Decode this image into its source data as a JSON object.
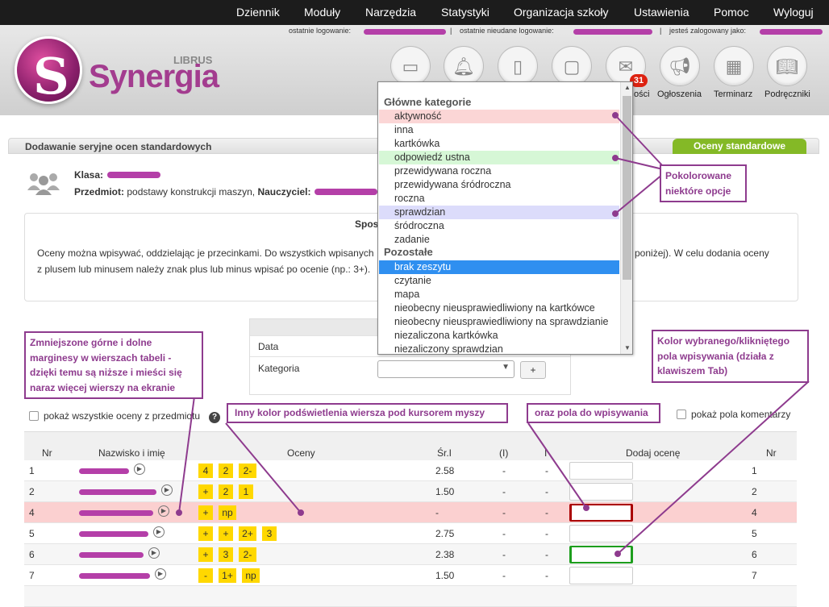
{
  "topnav": [
    "Dziennik",
    "Moduły",
    "Narzędzia",
    "Statystyki",
    "Organizacja szkoły",
    "Ustawienia",
    "Pomoc",
    "Wyloguj"
  ],
  "login": {
    "last": "ostatnie logowanie:",
    "last_failed": "ostatnie nieudane logowanie:",
    "logged_as": "jesteś zalogowany jako:",
    "sep": "|"
  },
  "logo": {
    "small": "LIBRUS",
    "big": "Synergia"
  },
  "header_icons": [
    {
      "icon": "chat-icon",
      "label": ""
    },
    {
      "icon": "bell-icon",
      "label": ""
    },
    {
      "icon": "calendar-5-icon",
      "label": ""
    },
    {
      "icon": "clipboard-icon",
      "label": ""
    },
    {
      "icon": "envelope-icon",
      "label": "ości"
    },
    {
      "icon": "megaphone-icon",
      "label": "Ogłoszenia"
    },
    {
      "icon": "organizer-icon",
      "label": "Terminarz"
    },
    {
      "icon": "book-icon",
      "label": "Podręczniki"
    }
  ],
  "badge": "31",
  "panel": {
    "title": "Dodawanie seryjne ocen standardowych",
    "tab": "Oceny standardowe",
    "klasa_label": "Klasa:",
    "przedmiot_label": "Przedmiot:",
    "przedmiot_value": "podstawy konstrukcji maszyn,",
    "nauczyciel_label": "Nauczyciel:"
  },
  "info": {
    "title": "Sposób",
    "line1a": "Oceny można wpisywać, oddzielając je przecinkami. Do wszystkich wpisanych",
    "line1b": "poniżej). W celu dodania oceny",
    "line2": "z plusem lub minusem należy znak plus lub minus wpisać po ocenie (np.: 3+)."
  },
  "form": {
    "data_label": "Data",
    "kategoria_label": "Kategoria",
    "plus": "+"
  },
  "checks": {
    "left": "pokaż wszystkie oceny z przedmiotu",
    "right": "pokaż pola komentarzy",
    "help": "?"
  },
  "table": {
    "headers": [
      "Nr",
      "Nazwisko i imię",
      "Oceny",
      "Śr.I",
      "(I)",
      "I",
      "Dodaj ocenę",
      "Nr"
    ],
    "rows": [
      {
        "nr": "1",
        "grades": [
          "4",
          "2",
          "2-"
        ],
        "sr": "2.58",
        "c1": "-",
        "c2": "-",
        "nr2": "1"
      },
      {
        "nr": "2",
        "grades": [
          "+",
          "2",
          "1"
        ],
        "sr": "1.50",
        "c1": "-",
        "c2": "-",
        "nr2": "2"
      },
      {
        "nr": "4",
        "grades": [
          "+",
          "np"
        ],
        "sr": "-",
        "c1": "-",
        "c2": "-",
        "nr2": "4"
      },
      {
        "nr": "5",
        "grades": [
          "+",
          "+",
          "2+",
          "3"
        ],
        "sr": "2.75",
        "c1": "-",
        "c2": "-",
        "nr2": "5"
      },
      {
        "nr": "6",
        "grades": [
          "+",
          "3",
          "2-"
        ],
        "sr": "2.38",
        "c1": "-",
        "c2": "-",
        "nr2": "6"
      },
      {
        "nr": "7",
        "grades": [
          "-",
          "1+",
          "np"
        ],
        "sr": "1.50",
        "c1": "-",
        "c2": "-",
        "nr2": "7"
      }
    ]
  },
  "dropdown": {
    "group1": "Główne kategorie",
    "group1_items": [
      "aktywność",
      "inna",
      "kartkówka",
      "odpowiedź ustna",
      "przewidywana roczna",
      "przewidywana śródroczna",
      "roczna",
      "sprawdzian",
      "śródroczna",
      "zadanie"
    ],
    "group2": "Pozostałe",
    "group2_items": [
      "brak zeszytu",
      "czytanie",
      "mapa",
      "nieobecny nieusprawiedliwiony na kartkówce",
      "nieobecny nieusprawiedliwiony na sprawdzianie",
      "niezaliczona kartkówka",
      "niezaliczony sprawdzian"
    ],
    "colors": {
      "highlight_red": "#fbd6d6",
      "highlight_green": "#d6f7d6",
      "highlight_violet": "#dcdcfb",
      "selected": "#2f8ff0"
    }
  },
  "annotations": {
    "colored": "Pokolorowane niektóre opcje",
    "margins": "Zmniejszone górne i dolne marginesy w wierszach tabeli - dzięki temu są niższe i mieści się naraz więcej wierszy na ekranie",
    "hover": "Inny kolor podświetlenia wiersza pod kursorem myszy",
    "field": "oraz pola do wpisywania",
    "selected": "Kolor wybranego/klikniętego pola wpisywania (działa z klawiszem Tab)"
  },
  "colors": {
    "accent": "#8e3b8e",
    "nav_bg": "#1c1c1c",
    "tab_green": "#84b926",
    "grade_yellow": "#ffd800",
    "row_hover": "#fbd0d0"
  }
}
